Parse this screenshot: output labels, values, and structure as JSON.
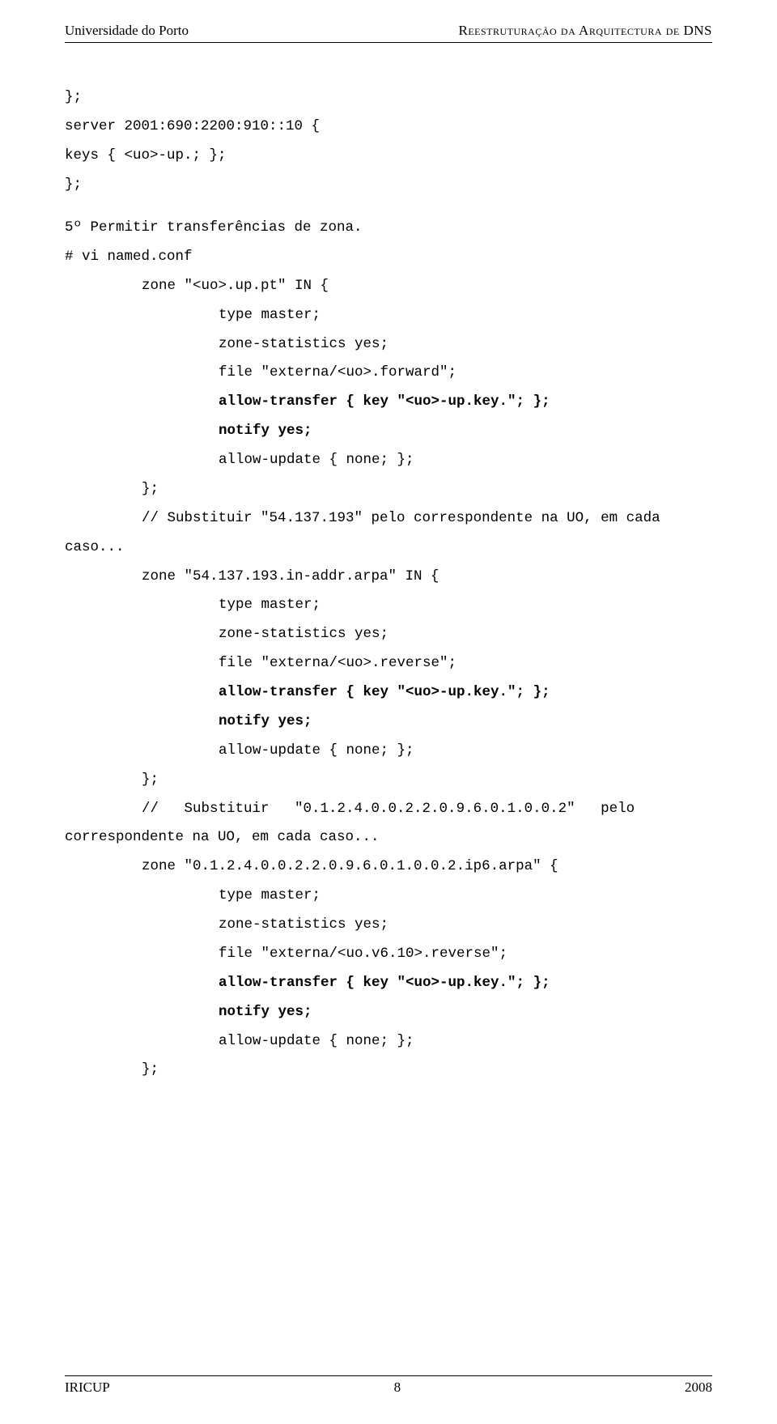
{
  "header": {
    "left": "Universidade do Porto",
    "right": "Reestruturação da Arquitectura de DNS"
  },
  "code": {
    "l1": "};",
    "l2": "server 2001:690:2200:910::10 {",
    "l3": "keys { <uo>-up.; };",
    "l4": "};",
    "l5": "",
    "l6": "5º Permitir transferências de zona.",
    "l7": "# vi named.conf",
    "l8": "zone \"<uo>.up.pt\" IN {",
    "l9": "type master;",
    "l10": "zone-statistics yes;",
    "l11": "file \"externa/<uo>.forward\";",
    "l12": "allow-transfer { key \"<uo>-up.key.\"; };",
    "l13": "notify yes;",
    "l14": "allow-update { none; };",
    "l15": "};",
    "l16a": "// Substituir \"54.137.193\" pelo correspondente na UO, em cada",
    "l16b": "caso...",
    "l17": "zone \"54.137.193.in-addr.arpa\" IN {",
    "l18": "type master;",
    "l19": "zone-statistics yes;",
    "l20": "file \"externa/<uo>.reverse\";",
    "l21": "allow-transfer { key \"<uo>-up.key.\"; };",
    "l22": "notify yes;",
    "l23": "allow-update { none; };",
    "l24": "};",
    "l25a": "//   Substituir   \"0.1.2.4.0.0.2.2.0.9.6.0.1.0.0.2\"   pelo",
    "l25b": "correspondente na UO, em cada caso...",
    "l26": "zone \"0.1.2.4.0.0.2.2.0.9.6.0.1.0.0.2.ip6.arpa\" {",
    "l27": "type master;",
    "l28": "zone-statistics yes;",
    "l29": "file \"externa/<uo.v6.10>.reverse\";",
    "l30": "allow-transfer { key \"<uo>-up.key.\"; };",
    "l31": "notify yes;",
    "l32": "allow-update { none; };",
    "l33": "};"
  },
  "footer": {
    "left": "IRICUP",
    "center": "8",
    "right": "2008"
  }
}
